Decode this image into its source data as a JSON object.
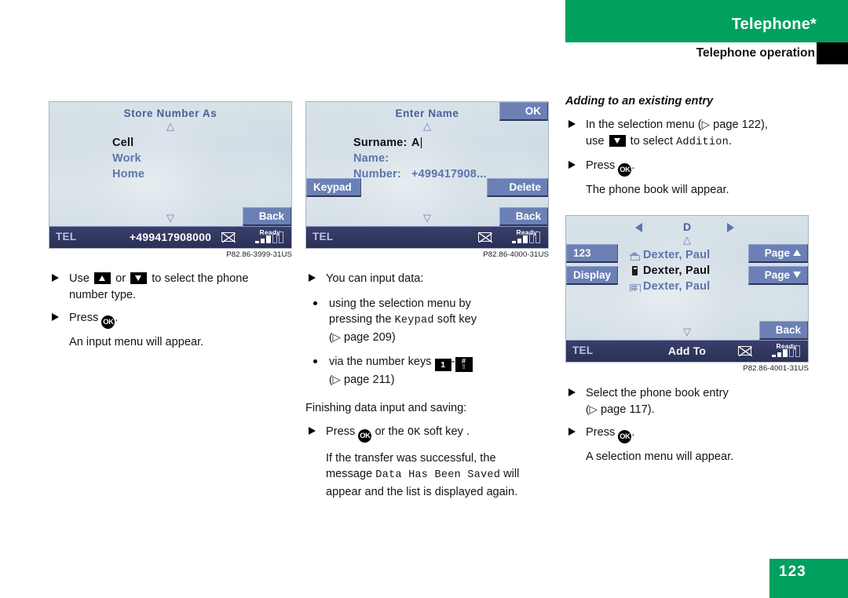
{
  "header": {
    "chapter": "Telephone*",
    "section": "Telephone operation",
    "green": "#00a15f"
  },
  "page_number": "123",
  "screens": {
    "store_number_as": {
      "title": "Store Number As",
      "menu": [
        {
          "label": "Cell",
          "selected": true
        },
        {
          "label": "Work",
          "selected": false
        },
        {
          "label": "Home",
          "selected": false
        }
      ],
      "softkeys": [
        {
          "label": "Back",
          "position": "bottom-right"
        }
      ],
      "statusbar": {
        "left": "TEL",
        "center": "+499417908000",
        "mail_icon": "envelope-icon",
        "signal_label": "Ready"
      },
      "caption": "P82.86-3999-31US"
    },
    "enter_name": {
      "title": "Enter Name",
      "fields": [
        {
          "label": "Surname:",
          "value": "A",
          "selected": true,
          "caret": true
        },
        {
          "label": "Name:",
          "value": "",
          "selected": false,
          "caret": false
        },
        {
          "label": "Number:",
          "value": "+499417908...",
          "selected": false,
          "caret": false
        }
      ],
      "softkeys": [
        {
          "label": "OK",
          "position": "top-right"
        },
        {
          "label": "Keypad",
          "position": "mid-left"
        },
        {
          "label": "Delete",
          "position": "mid-right"
        },
        {
          "label": "Back",
          "position": "bottom-right"
        }
      ],
      "statusbar": {
        "left": "TEL",
        "center": "",
        "mail_icon": "envelope-icon",
        "signal_label": "Ready"
      },
      "caption": "P82.86-4000-31US"
    },
    "phone_book": {
      "letter": "D",
      "entries": [
        {
          "icon": "home-icon",
          "name": "Dexter, Paul",
          "selected": false
        },
        {
          "icon": "mobile-icon",
          "name": "Dexter, Paul",
          "selected": true
        },
        {
          "icon": "office-icon",
          "name": "Dexter, Paul",
          "selected": false
        }
      ],
      "softkeys": [
        {
          "label": "123",
          "position": "mid-left"
        },
        {
          "label": "Display",
          "position": "mid-left-2"
        },
        {
          "label": "Page",
          "arrow": "up",
          "position": "mid-right"
        },
        {
          "label": "Page",
          "arrow": "down",
          "position": "mid-right-2"
        },
        {
          "label": "Back",
          "position": "bottom-right"
        }
      ],
      "statusbar": {
        "left": "TEL",
        "center": "Add To",
        "mail_icon": "envelope-icon",
        "signal_label": "Ready"
      },
      "caption": "P82.86-4001-31US"
    }
  },
  "col_left": {
    "step1_a": "Use",
    "step1_b": "or",
    "step1_c": "to select the phone",
    "step1_d": "number type.",
    "step2_a": "Press",
    "step2_b": ".",
    "step2_note": "An input menu will appear."
  },
  "col_mid": {
    "intro": "You can input data:",
    "bullet1_a": "using the selection menu by",
    "bullet1_b": "pressing the",
    "bullet1_key": "Keypad",
    "bullet1_c": "soft key",
    "bullet1_ref": "page 209)",
    "bullet2_a": "via the number keys",
    "bullet2_key1": "1",
    "bullet2_dash": "-",
    "bullet2_key2_top": "#",
    "bullet2_key2_bot": "⇧",
    "bullet2_ref": "page 211)",
    "finish_head": "Finishing data input and saving:",
    "finish_step_a": "Press",
    "finish_step_b": "or the",
    "finish_step_key": "OK",
    "finish_step_c": "soft key .",
    "result_l1": "If the transfer was successful, the",
    "result_l2_a": "message",
    "result_l2_key": "Data Has Been Saved",
    "result_l2_b": "will",
    "result_l3": "appear and the list is displayed again."
  },
  "col_right": {
    "heading": "Adding to an existing entry",
    "step1_a": "In the selection menu (",
    "step1_ref": "page 122),",
    "step1_b": "use",
    "step1_c": "to select",
    "step1_key": "Addition",
    "step1_d": ".",
    "step2_a": "Press",
    "step2_b": ".",
    "step2_note": "The phone book will appear.",
    "step3_a": "Select the phone book entry",
    "step3_ref": "page 117).",
    "step4_a": "Press",
    "step4_b": ".",
    "step4_note": "A selection menu will appear."
  }
}
